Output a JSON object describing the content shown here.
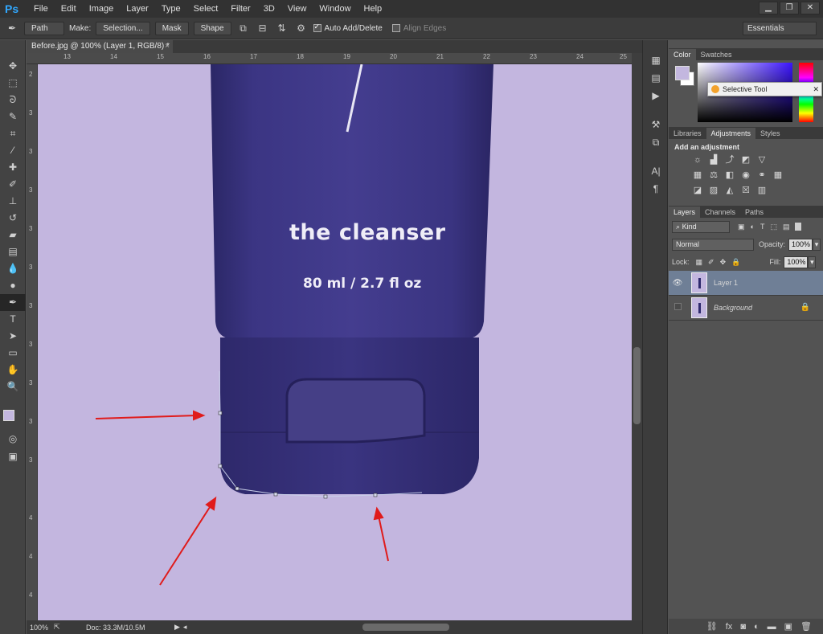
{
  "app": {
    "logo": "Ps"
  },
  "menu": [
    "File",
    "Edit",
    "Image",
    "Layer",
    "Type",
    "Select",
    "Filter",
    "3D",
    "View",
    "Window",
    "Help"
  ],
  "window_controls": {
    "minimize": "▁",
    "restore": "❐",
    "close": "✕"
  },
  "options_bar": {
    "tool_mode": "Path",
    "make_label": "Make:",
    "selection_button": "Selection...",
    "mask_button": "Mask",
    "shape_button": "Shape",
    "auto_add_delete_label": "Auto Add/Delete",
    "auto_add_delete_checked": true,
    "align_edges_label": "Align Edges",
    "align_edges_checked": false,
    "workspace": "Essentials"
  },
  "document": {
    "tab_title": "Before.jpg @ 100% (Layer 1, RGB/8) *",
    "ruler_h": [
      "13",
      "14",
      "15",
      "16",
      "17",
      "18",
      "19",
      "20",
      "21",
      "22",
      "23",
      "24",
      "25"
    ],
    "ruler_v": [
      "2",
      "3",
      "3",
      "3",
      "3",
      "3",
      "3",
      "3",
      "3",
      "3",
      "3",
      "4",
      "4",
      "4"
    ],
    "product_title": "the cleanser",
    "product_volume": "80 ml / 2.7 fl oz",
    "canvas_color": "#c3b6df",
    "bottle_color": "#3a347e"
  },
  "status": {
    "zoom": "100%",
    "doc_size": "Doc: 33.3M/10.5M"
  },
  "color_panel": {
    "tabs": [
      "Color",
      "Swatches"
    ],
    "foreground": "#c3b7df",
    "background": "#ffffff",
    "tooltip": "Selective Tool"
  },
  "adjustments_panel": {
    "tabs": [
      "Libraries",
      "Adjustments",
      "Styles"
    ],
    "title": "Add an adjustment"
  },
  "layers_panel": {
    "tabs": [
      "Layers",
      "Channels",
      "Paths"
    ],
    "kind": "Kind",
    "blend_mode": "Normal",
    "opacity_label": "Opacity:",
    "opacity": "100%",
    "lock_label": "Lock:",
    "fill_label": "Fill:",
    "fill": "100%",
    "layers": [
      {
        "name": "Layer 1",
        "visible": true,
        "selected": true
      },
      {
        "name": "Background",
        "visible": false,
        "selected": false,
        "locked": true
      }
    ]
  }
}
